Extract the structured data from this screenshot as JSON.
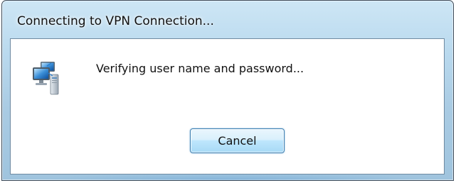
{
  "window": {
    "title": "Connecting to VPN Connection..."
  },
  "dialog": {
    "icon": "network-computer-icon",
    "message": "Verifying user name and password...",
    "cancel_label": "Cancel"
  },
  "colors": {
    "frame": "#b9d9ee",
    "button_border": "#3c7fb1",
    "button_fill": "#bee6fd"
  }
}
